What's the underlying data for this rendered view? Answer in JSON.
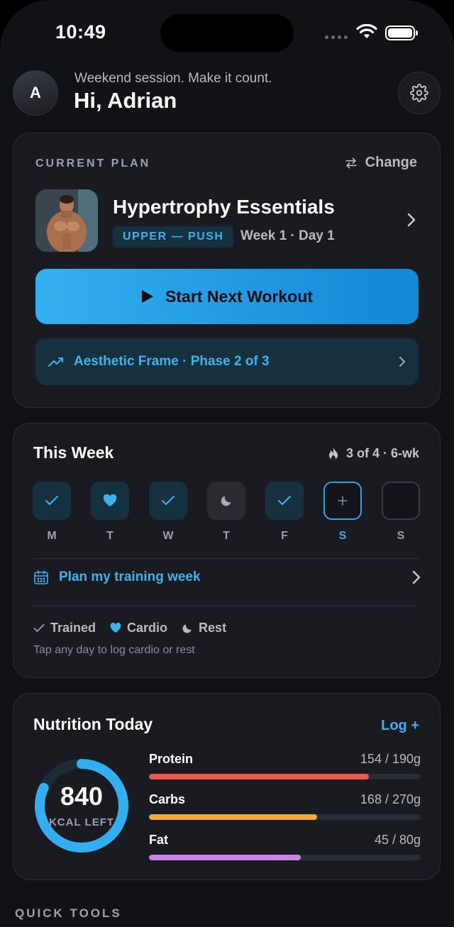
{
  "status_bar": {
    "time": "10:49"
  },
  "header": {
    "avatar_initial": "A",
    "subtitle": "Weekend session. Make it count.",
    "greeting": "Hi, Adrian"
  },
  "plan_card": {
    "label": "CURRENT PLAN",
    "change_label": "Change",
    "title": "Hypertrophy Essentials",
    "tag": "UPPER — PUSH",
    "week_day": "Week 1 · Day 1",
    "start_button": "Start Next Workout",
    "phase": "Aesthetic Frame · Phase 2 of 3"
  },
  "week_card": {
    "title": "This Week",
    "streak": "3 of 4 · 6-wk",
    "days": [
      {
        "letter": "M",
        "state": "trained"
      },
      {
        "letter": "T",
        "state": "cardio"
      },
      {
        "letter": "W",
        "state": "trained"
      },
      {
        "letter": "T",
        "state": "rest"
      },
      {
        "letter": "F",
        "state": "trained"
      },
      {
        "letter": "S",
        "state": "today"
      },
      {
        "letter": "S",
        "state": "empty"
      }
    ],
    "plan_week_label": "Plan my training week",
    "legend": {
      "trained": "Trained",
      "cardio": "Cardio",
      "rest": "Rest"
    },
    "hint": "Tap any day to log cardio or rest"
  },
  "nutrition": {
    "title": "Nutrition Today",
    "log_label": "Log +",
    "kcal_left": "840",
    "kcal_label": "KCAL LEFT",
    "ring_progress": 0.82,
    "macros": [
      {
        "name": "Protein",
        "value": "154 / 190g",
        "fraction": 0.81,
        "color": "#f0584c"
      },
      {
        "name": "Carbs",
        "value": "168 / 270g",
        "fraction": 0.62,
        "color": "#f4a93a"
      },
      {
        "name": "Fat",
        "value": "45 / 80g",
        "fraction": 0.56,
        "color": "#c685e0"
      }
    ]
  },
  "quick_tools_label": "QUICK TOOLS",
  "colors": {
    "accent": "#2ba5e8",
    "background": "#111216",
    "card": "#1a1b20"
  }
}
